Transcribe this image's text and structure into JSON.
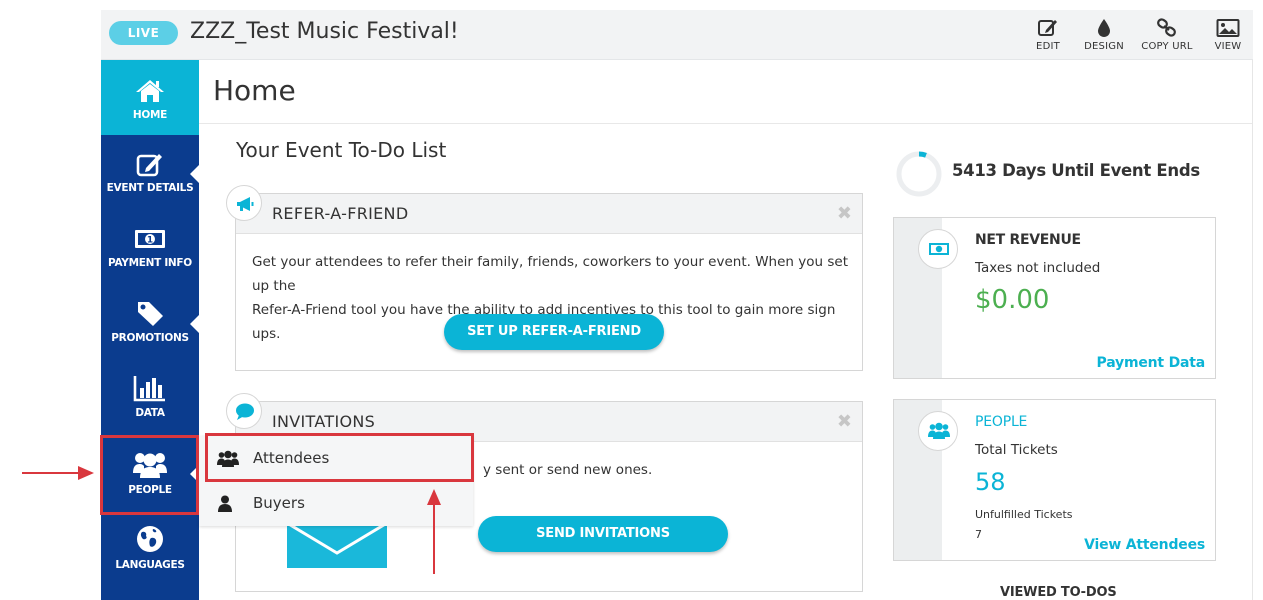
{
  "topbar": {
    "live_label": "LIVE",
    "event_title": "ZZZ_Test Music Festival!",
    "actions": [
      {
        "label": "EDIT",
        "icon": "edit-icon"
      },
      {
        "label": "DESIGN",
        "icon": "drop-icon"
      },
      {
        "label": "COPY URL",
        "icon": "link-icon"
      },
      {
        "label": "VIEW",
        "icon": "image-icon"
      }
    ]
  },
  "sidebar": {
    "items": [
      {
        "label": "HOME",
        "icon": "home-icon",
        "active": true
      },
      {
        "label": "EVENT DETAILS",
        "icon": "edit-icon"
      },
      {
        "label": "PAYMENT INFO",
        "icon": "money-icon"
      },
      {
        "label": "PROMOTIONS",
        "icon": "tag-icon"
      },
      {
        "label": "DATA",
        "icon": "bar-chart-icon"
      },
      {
        "label": "PEOPLE",
        "icon": "users-icon"
      },
      {
        "label": "LANGUAGES",
        "icon": "globe-icon"
      }
    ]
  },
  "main": {
    "page_title": "Home",
    "todo_title": "Your Event To-Do List",
    "refer_card": {
      "title": "REFER-A-FRIEND",
      "close": "✖",
      "text_line1": "Get your attendees to refer their family, friends, coworkers to your event. When you set up the",
      "text_line2": "Refer-A-Friend tool you have the ability to add incentives to this tool to gain more sign ups.",
      "button": "SET UP REFER-A-FRIEND"
    },
    "invitations_card": {
      "title": "INVITATIONS",
      "close": "✖",
      "text_partial": "y sent or send new ones.",
      "button": "SEND INVITATIONS"
    }
  },
  "people_menu": {
    "items": [
      {
        "label": "Attendees",
        "icon": "users-icon"
      },
      {
        "label": "Buyers",
        "icon": "user-icon"
      }
    ]
  },
  "right": {
    "countdown_text": "5413 Days Until Event Ends",
    "net_revenue": {
      "title": "NET REVENUE",
      "subtitle": "Taxes not included",
      "value": "$0.00",
      "link": "Payment Data"
    },
    "people": {
      "title": "PEOPLE",
      "subtitle": "Total Tickets",
      "value": "58",
      "unfulfilled_label": "Unfulfilled Tickets",
      "unfulfilled_value": "7",
      "link": "View Attendees"
    },
    "viewed_todos": "VIEWED TO-DOS"
  },
  "colors": {
    "sidebar_bg": "#0b3c8e",
    "accent": "#0bb4d6",
    "live_badge": "#5ccfe6",
    "revenue_green": "#4caf50",
    "annotation_red": "#d9373e"
  }
}
